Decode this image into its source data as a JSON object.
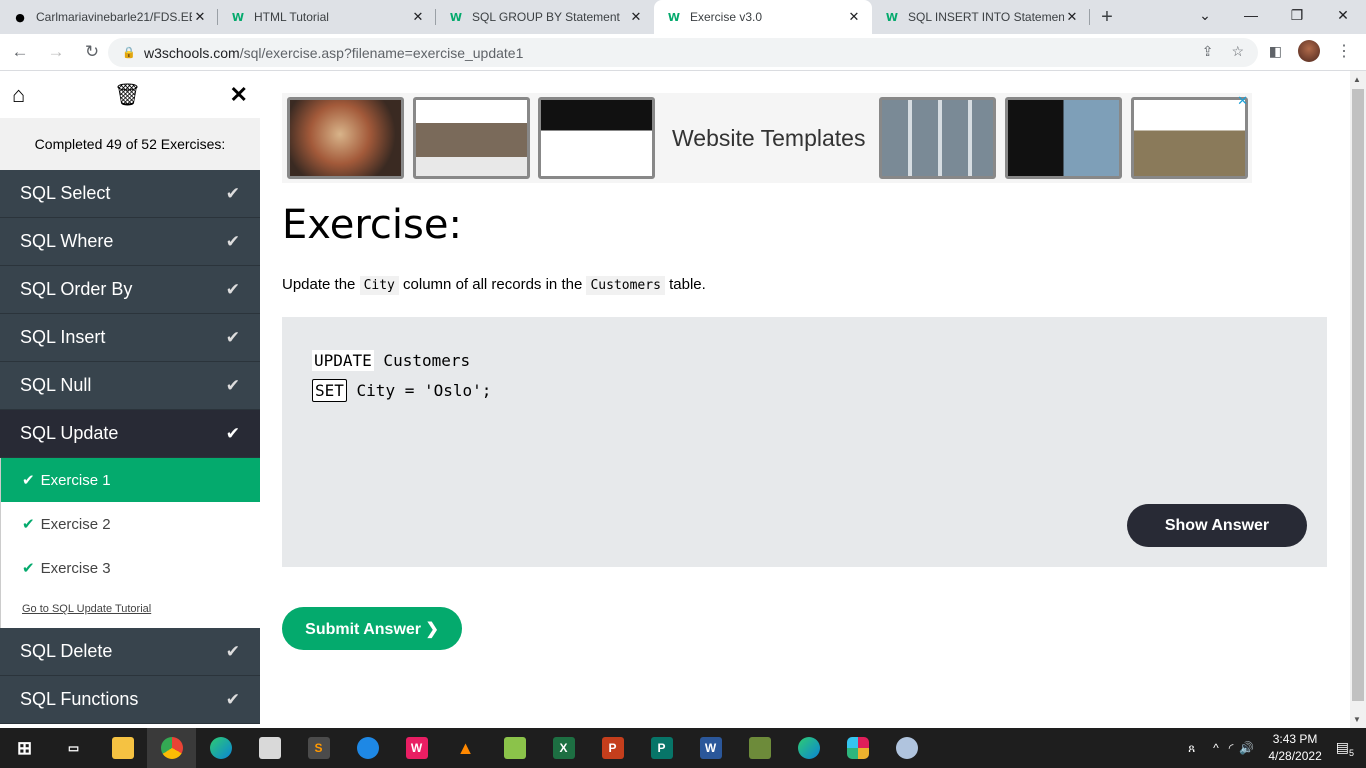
{
  "browser": {
    "tabs": [
      {
        "title": "Carlmariavinebarle21/FDS.EB",
        "icon": "github-icon",
        "active": false
      },
      {
        "title": "HTML Tutorial",
        "icon": "w3schools-icon",
        "active": false
      },
      {
        "title": "SQL GROUP BY Statement",
        "icon": "w3schools-icon",
        "active": false
      },
      {
        "title": "Exercise v3.0",
        "icon": "w3schools-icon",
        "active": true
      },
      {
        "title": "SQL INSERT INTO Statement",
        "icon": "w3schools-icon",
        "active": false
      }
    ],
    "url_host": "w3schools.com",
    "url_path": "/sql/exercise.asp?filename=exercise_update1"
  },
  "sidebar": {
    "completed_text": "Completed 49 of 52 Exercises:",
    "sections_before": [
      {
        "label": "SQL Select"
      },
      {
        "label": "SQL Where"
      },
      {
        "label": "SQL Order By"
      },
      {
        "label": "SQL Insert"
      },
      {
        "label": "SQL Null"
      },
      {
        "label": "SQL Update"
      }
    ],
    "exercises": [
      {
        "label": "Exercise 1",
        "active": true
      },
      {
        "label": "Exercise 2",
        "active": false
      },
      {
        "label": "Exercise 3",
        "active": false
      }
    ],
    "tutorial_link": "Go to SQL Update Tutorial",
    "sections_after": [
      {
        "label": "SQL Delete"
      },
      {
        "label": "SQL Functions"
      }
    ]
  },
  "ad": {
    "text": "Website Templates"
  },
  "exercise": {
    "heading": "Exercise:",
    "desc_pre": "Update the ",
    "desc_code1": "City",
    "desc_mid": " column of all records in the ",
    "desc_code2": "Customers",
    "desc_post": " table.",
    "line1_kw": "UPDATE",
    "line1_rest": " Customers",
    "line2_kw": "SET",
    "line2_rest": " City = 'Oslo';",
    "show_answer": "Show Answer",
    "submit": "Submit Answer ❯"
  },
  "taskbar": {
    "time": "3:43 PM",
    "date": "4/28/2022",
    "notifications": "5"
  },
  "colors": {
    "accent": "#04aa6d",
    "sidebar_bg": "#38444d",
    "dark_button": "#282a35"
  }
}
